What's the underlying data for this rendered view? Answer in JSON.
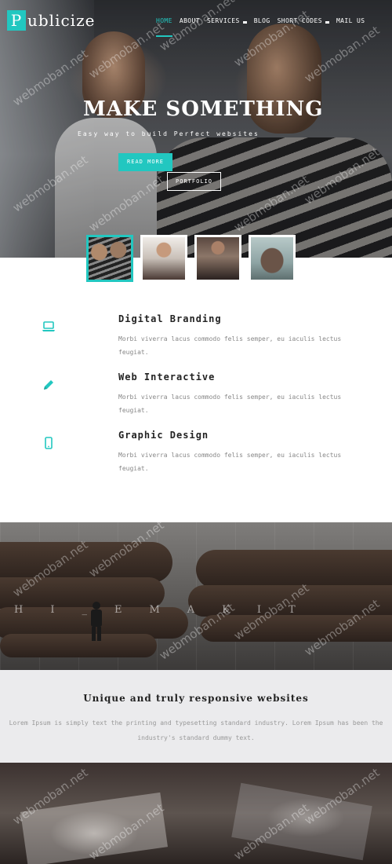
{
  "brand": {
    "first_letter": "P",
    "rest": "ublicize"
  },
  "nav": {
    "items": [
      {
        "label": "HOME",
        "active": true,
        "dropdown": false
      },
      {
        "label": "ABOUT",
        "active": false,
        "dropdown": false
      },
      {
        "label": "SERVICES",
        "active": false,
        "dropdown": true
      },
      {
        "label": "BLOG",
        "active": false,
        "dropdown": false
      },
      {
        "label": "SHORT CODES",
        "active": false,
        "dropdown": true
      },
      {
        "label": "MAIL US",
        "active": false,
        "dropdown": false
      }
    ]
  },
  "hero": {
    "title": "MAKE SOMETHING",
    "subtitle": "Easy way to build Perfect websites",
    "read_more": "READ MORE",
    "portfolio": "PORTFOLIO"
  },
  "thumbnails": [
    {
      "name": "thumb-1",
      "active": true
    },
    {
      "name": "thumb-2",
      "active": false
    },
    {
      "name": "thumb-3",
      "active": false
    },
    {
      "name": "thumb-4",
      "active": false
    }
  ],
  "services": [
    {
      "icon": "laptop-icon",
      "title": "Digital Branding",
      "desc": "Morbi viverra lacus commodo felis semper, eu iaculis lectus feugiat."
    },
    {
      "icon": "pencil-icon",
      "title": "Web Interactive",
      "desc": "Morbi viverra lacus commodo felis semper, eu iaculis lectus feugiat."
    },
    {
      "icon": "mobile-icon",
      "title": "Graphic Design",
      "desc": "Morbi viverra lacus commodo felis semper, eu iaculis lectus feugiat."
    }
  ],
  "hands_section": {
    "ghost_text": "HI_EMAKIT"
  },
  "banner": {
    "title": "Unique and truly responsive websites",
    "text": "Lorem Ipsum is simply text the printing and typesetting standard industry. Lorem Ipsum has been the industry's standard dummy text."
  },
  "watermark": "webmoban.net",
  "colors": {
    "accent": "#22c7c0",
    "banner_bg": "#ebebed"
  }
}
